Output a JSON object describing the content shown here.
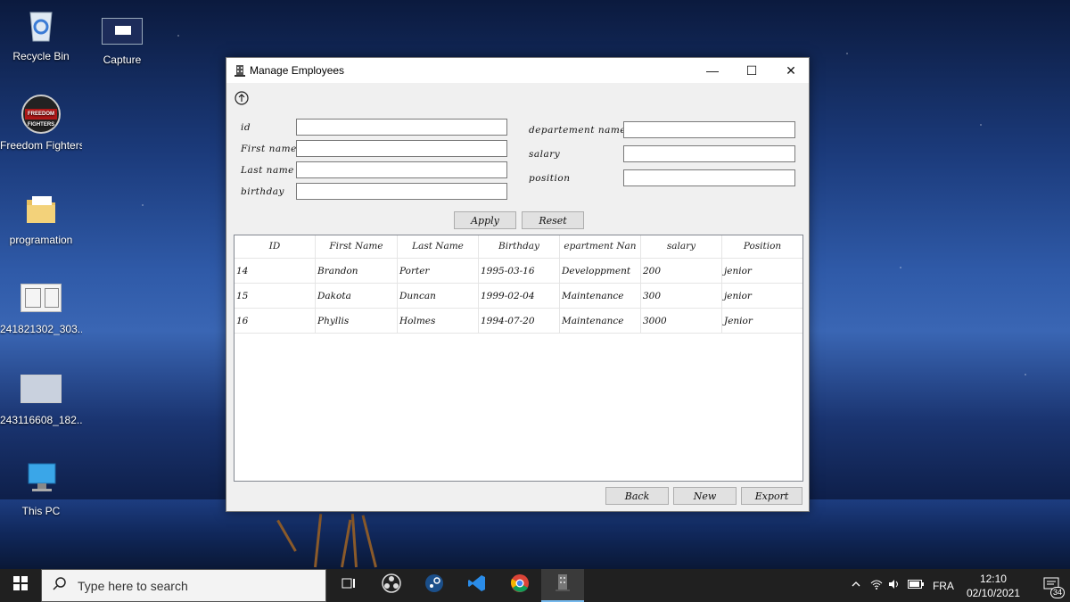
{
  "desktop": {
    "icons": [
      {
        "label": "Recycle Bin"
      },
      {
        "label": "Capture"
      },
      {
        "label": "Freedom Fighters"
      },
      {
        "label": "programation"
      },
      {
        "label": "241821302_303..."
      },
      {
        "label": "243116608_182..."
      },
      {
        "label": "This PC"
      }
    ],
    "freedom_logo_text": "FREEDOM FIGHTERS"
  },
  "window": {
    "title": "Manage Employees",
    "controls": {
      "minimize": "—",
      "maximize": "☐",
      "close": "✕"
    },
    "form": {
      "id_label": "id",
      "first_name_label": "First  name",
      "last_name_label": "Last  name",
      "birthday_label": "birthday",
      "department_label": "departement  name",
      "salary_label": "salary",
      "position_label": "position",
      "id_value": "",
      "first_name_value": "",
      "last_name_value": "",
      "birthday_value": "",
      "department_value": "",
      "salary_value": "",
      "position_value": ""
    },
    "buttons": {
      "apply": "Apply",
      "reset": "Reset",
      "back": "Back",
      "new": "New",
      "export": "Export"
    },
    "table": {
      "columns": [
        "ID",
        "First  Name",
        "Last  Name",
        "Birthday",
        "epartment  Nan",
        "salary",
        "Position"
      ],
      "rows": [
        [
          "14",
          "Brandon",
          "Porter",
          "1995-03-16",
          "Developpment",
          "200",
          "jenior"
        ],
        [
          "15",
          "Dakota",
          "Duncan",
          "1999-02-04",
          "Maintenance",
          "300",
          "jenior"
        ],
        [
          "16",
          "Phyllis",
          "Holmes",
          "1994-07-20",
          "Maintenance",
          "3000",
          "Jenior"
        ]
      ]
    }
  },
  "taskbar": {
    "search_placeholder": "Type here to search",
    "language": "FRA",
    "time": "12:10",
    "date": "02/10/2021",
    "notifications": "34"
  }
}
